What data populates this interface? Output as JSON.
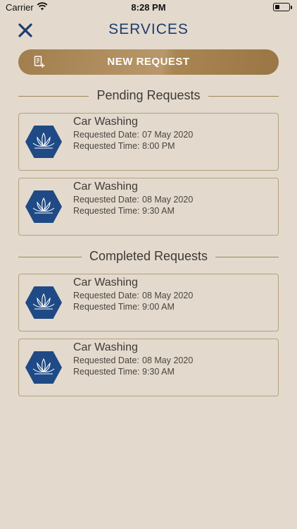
{
  "status_bar": {
    "carrier": "Carrier",
    "time": "8:28 PM",
    "battery_level": 0.25
  },
  "header": {
    "title": "SERVICES",
    "close_icon": "close-icon"
  },
  "new_request": {
    "label": "NEW REQUEST",
    "icon": "document-add-icon"
  },
  "pending": {
    "title": "Pending Requests",
    "items": [
      {
        "name": "Car Washing",
        "date_label": "Requested Date:",
        "date": "07 May 2020",
        "time_label": "Requested Time:",
        "time": "8:00 PM"
      },
      {
        "name": "Car Washing",
        "date_label": "Requested Date:",
        "date": "08 May 2020",
        "time_label": "Requested Time:",
        "time": "9:30 AM"
      }
    ]
  },
  "completed": {
    "title": "Completed Requests",
    "items": [
      {
        "name": "Car Washing",
        "date_label": "Requested Date:",
        "date": "08 May 2020",
        "time_label": "Requested Time:",
        "time": "9:00 AM"
      },
      {
        "name": "Car Washing",
        "date_label": "Requested Date:",
        "date": "08 May 2020",
        "time_label": "Requested Time:",
        "time": "9:30 AM"
      }
    ]
  },
  "colors": {
    "background": "#e3dacd",
    "title_blue": "#1e3c6e",
    "gold": "#a98552",
    "hex_blue": "#1f4a85"
  }
}
